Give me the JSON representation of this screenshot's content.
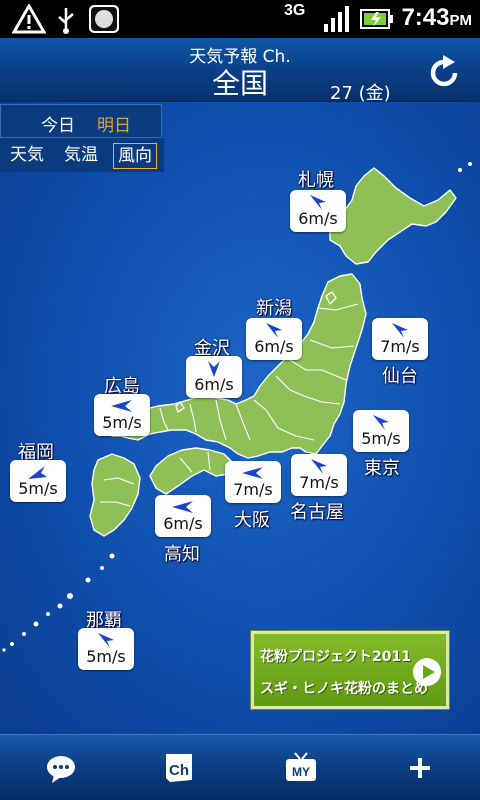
{
  "status_bar": {
    "network": "3G",
    "time": "7:43",
    "ampm": "PM",
    "icons": [
      "warning-icon",
      "usb-icon",
      "app-notification-icon",
      "signal-icon",
      "battery-icon"
    ]
  },
  "header": {
    "app_title": "天気予報 Ch.",
    "region": "全国",
    "date": "27 (金)"
  },
  "day_tabs": [
    {
      "label": "今日",
      "selected": false
    },
    {
      "label": "明日",
      "selected": true
    }
  ],
  "layer_tabs": [
    {
      "label": "天気",
      "selected": false
    },
    {
      "label": "気温",
      "selected": false
    },
    {
      "label": "風向",
      "selected": true
    }
  ],
  "cities": [
    {
      "name": "札幌",
      "wind": "6m/s",
      "direction": "north-west"
    },
    {
      "name": "新潟",
      "wind": "6m/s",
      "direction": "north-west"
    },
    {
      "name": "仙台",
      "wind": "7m/s",
      "direction": "north-west"
    },
    {
      "name": "金沢",
      "wind": "6m/s",
      "direction": "south"
    },
    {
      "name": "広島",
      "wind": "5m/s",
      "direction": "west"
    },
    {
      "name": "東京",
      "wind": "5m/s",
      "direction": "north-west"
    },
    {
      "name": "福岡",
      "wind": "5m/s",
      "direction": "south-west"
    },
    {
      "name": "大阪",
      "wind": "7m/s",
      "direction": "west"
    },
    {
      "name": "名古屋",
      "wind": "7m/s",
      "direction": "north-west"
    },
    {
      "name": "高知",
      "wind": "6m/s",
      "direction": "west"
    },
    {
      "name": "那覇",
      "wind": "5m/s",
      "direction": "north-west"
    }
  ],
  "banner": {
    "line1": "花粉プロジェクト2011",
    "line2": "スギ・ヒノキ花粉のまとめ"
  },
  "bottom_nav": [
    "chat-icon",
    "channel-icon",
    "my-tv-icon",
    "add-icon"
  ],
  "colors": {
    "header_blue": "#0a3f86",
    "sea_blue": "#1559b8",
    "land_green": "#8fc057",
    "selected_orange": "#f0a020",
    "banner_green": "#6aa81a"
  }
}
